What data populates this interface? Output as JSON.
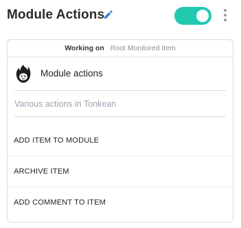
{
  "header": {
    "title": "Module Actions",
    "toggle_on": true,
    "accent_color": "#22c9b0"
  },
  "card": {
    "working_on_label": "Working on",
    "working_on_value": "Root Monitored Item",
    "module_icon": "tonkean-flame-logo",
    "module_name": "Module actions",
    "description": "Various actions in Tonkean",
    "actions": [
      {
        "label": "ADD ITEM TO MODULE"
      },
      {
        "label": "ARCHIVE ITEM"
      },
      {
        "label": "ADD COMMENT TO ITEM"
      }
    ]
  }
}
